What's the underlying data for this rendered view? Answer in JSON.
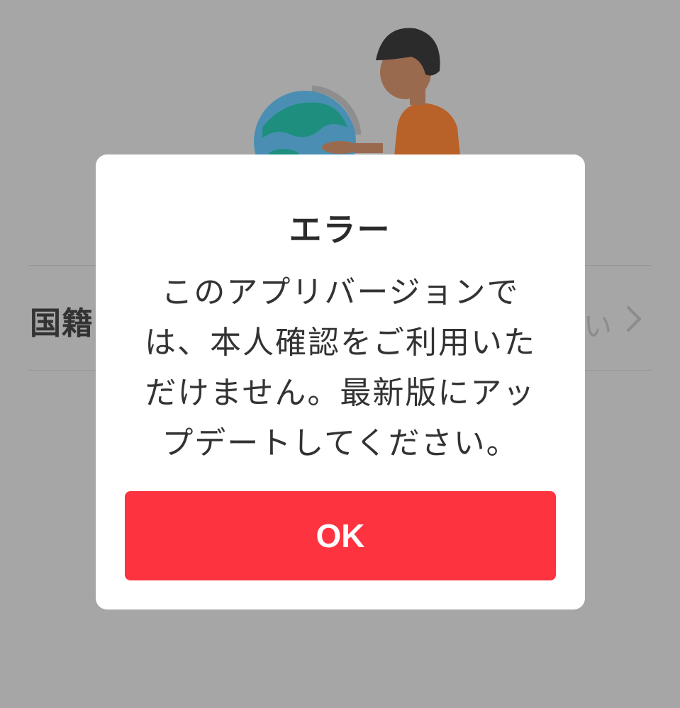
{
  "background": {
    "row_label": "国籍",
    "row_value": "い",
    "chevron_icon": "chevron-right-icon"
  },
  "dialog": {
    "title": "エラー",
    "message": "このアプリバージョンでは、本人確認をご利用いただけません。最新版にアップデートしてください。",
    "ok_label": "OK"
  },
  "colors": {
    "overlay": "#a6a6a6",
    "button": "#fe3340",
    "globe_sea": "#4a8fb3",
    "globe_land": "#1e8f7f",
    "shirt": "#b8622a",
    "hair": "#2b2b2b"
  }
}
